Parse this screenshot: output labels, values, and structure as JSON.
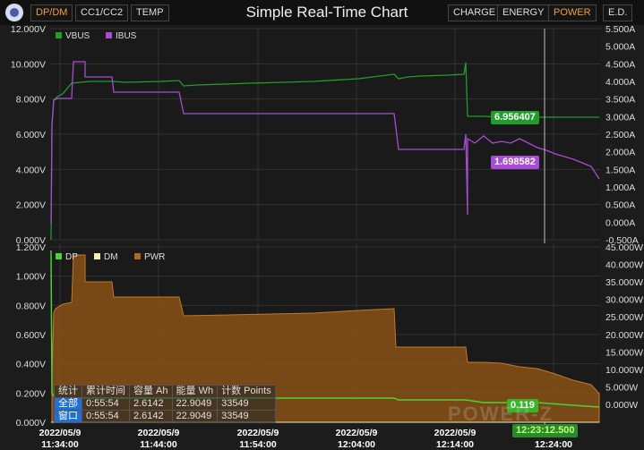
{
  "window": {
    "title": "Simple Real-Time Chart",
    "left_tabs": [
      "DP/DM",
      "CC1/CC2",
      "TEMP"
    ],
    "right_tabs": [
      "CHARGE",
      "ENERGY",
      "POWER",
      "E.D."
    ],
    "active_left": "DP/DM",
    "active_right": "POWER"
  },
  "colors": {
    "vbus": "#1f9e2a",
    "ibus": "#a94ad8",
    "dp": "#4cd137",
    "dm": "#f5f0b0",
    "pwr": "#b06a20",
    "accent": "#f0a030"
  },
  "top_chart": {
    "left_ticks": [
      "12.000V",
      "10.000V",
      "8.000V",
      "6.000V",
      "4.000V",
      "2.000V",
      "0.000V"
    ],
    "right_ticks": [
      "5.500A",
      "5.000A",
      "4.500A",
      "4.000A",
      "3.500A",
      "3.000A",
      "2.500A",
      "2.000A",
      "1.500A",
      "1.000A",
      "0.500A",
      "0.000A",
      "-0.500A"
    ],
    "legend": [
      "VBUS",
      "IBUS"
    ],
    "vbus_readout": "6.956407",
    "ibus_readout": "1.698582"
  },
  "bottom_chart": {
    "left_ticks": [
      "1.200V",
      "1.000V",
      "0.800V",
      "0.600V",
      "0.400V",
      "0.200V",
      "0.000V"
    ],
    "right_ticks": [
      "45.000W",
      "40.000W",
      "35.000W",
      "30.000W",
      "25.000W",
      "20.000W",
      "15.000W",
      "10.000W",
      "5.000W",
      "0.000W"
    ],
    "legend": [
      "DP",
      "DM",
      "PWR"
    ],
    "dp_readout": "0.119",
    "cursor_time": "12:23:12.500"
  },
  "x_axis": [
    {
      "date": "2022/05/9",
      "time": "11:34:00"
    },
    {
      "date": "2022/05/9",
      "time": "11:44:00"
    },
    {
      "date": "2022/05/9",
      "time": "11:54:00"
    },
    {
      "date": "2022/05/9",
      "time": "12:04:00"
    },
    {
      "date": "2022/05/9",
      "time": "12:14:00"
    },
    {
      "date": "2022/05/9",
      "time": "12:24:00"
    }
  ],
  "stats_table": {
    "headers": [
      "统计",
      "累计时间",
      "容量 Ah",
      "能量 Wh",
      "计数 Points"
    ],
    "rows": [
      [
        "全部",
        "0:55:54",
        "2.6142",
        "22.9049",
        "33549"
      ],
      [
        "窗口",
        "0:55:54",
        "2.6142",
        "22.9049",
        "33549"
      ]
    ]
  },
  "watermark": "POWER-Z"
}
